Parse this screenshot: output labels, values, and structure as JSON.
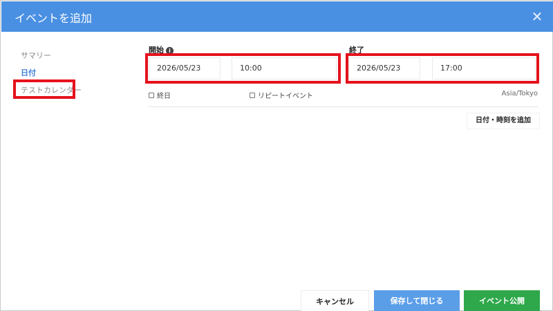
{
  "dialog": {
    "title": "イベントを追加",
    "close_icon": "close-icon",
    "close_glyph": "✕"
  },
  "sidebar": {
    "items": [
      {
        "label": "サマリー",
        "active": false
      },
      {
        "label": "日付",
        "active": true
      },
      {
        "label": "テストカレンダー",
        "active": false
      }
    ]
  },
  "start": {
    "label": "開始",
    "info_glyph": "i",
    "date": "2026/05/23",
    "time": "10:00"
  },
  "end": {
    "label": "終了",
    "date": "2026/05/23",
    "time": "17:00"
  },
  "options": {
    "all_day_label": "終日",
    "repeat_label": "リピートイベント",
    "timezone": "Asia/Tokyo"
  },
  "add_datetime_label": "日付・時刻を追加",
  "footer": {
    "cancel_label": "キャンセル",
    "save_close_label": "保存して閉じる",
    "publish_label": "イベント公開"
  },
  "colors": {
    "header": "#4a90e2",
    "active_nav": "#3b7dd8",
    "highlight": "#e5121d",
    "save_button": "#5a9ee8",
    "publish_button": "#2ea84a"
  }
}
